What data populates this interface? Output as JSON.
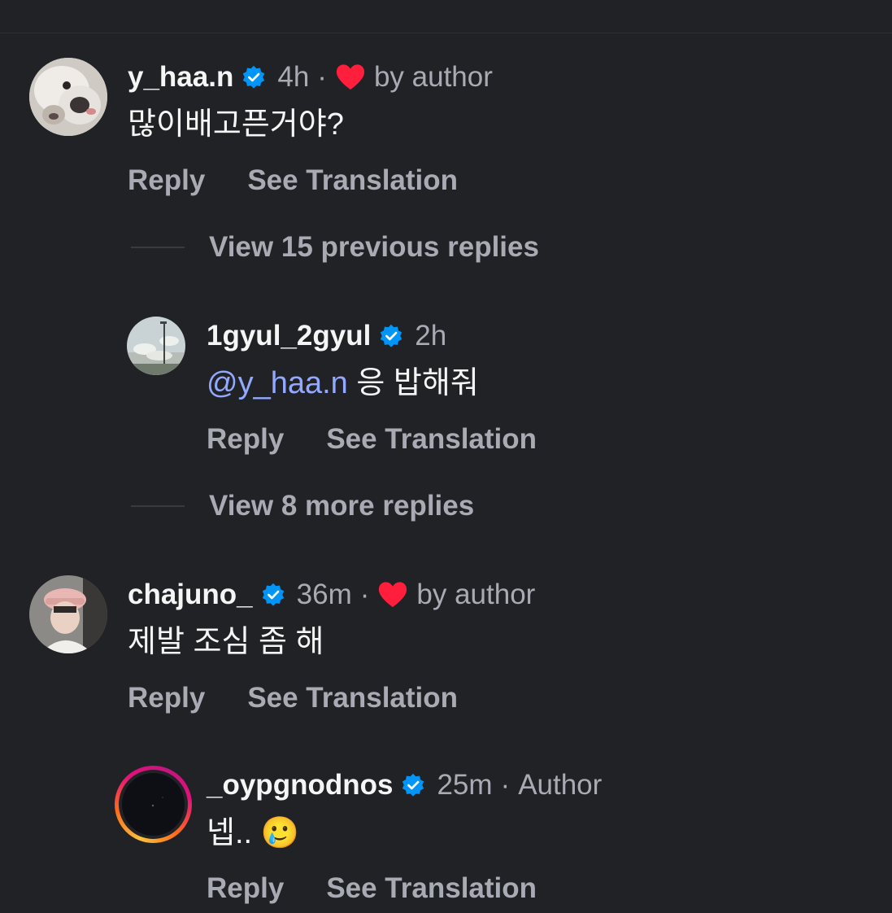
{
  "colors": {
    "background": "#212226",
    "primary_text": "#f5f5f5",
    "secondary_text": "#a8abb3",
    "mention": "#92a9ff",
    "verified_badge": "#0095f6",
    "heart": "#ff1f3d"
  },
  "comments": [
    {
      "username": "y_haa.n",
      "verified": true,
      "time": "4h",
      "liked_by_author": true,
      "liked_label": "by author",
      "text": "많이배고픈거야?",
      "reply_label": "Reply",
      "translate_label": "See Translation",
      "avatar_icon": "avatar-dog-photo",
      "view_previous_label": "View 15 previous replies",
      "replies": [
        {
          "username": "1gyul_2gyul",
          "verified": true,
          "time": "2h",
          "mention": "@y_haa.n",
          "text": "응 밥해줘",
          "reply_label": "Reply",
          "translate_label": "See Translation",
          "avatar_icon": "avatar-sky-photo"
        }
      ],
      "view_more_label": "View 8 more replies"
    },
    {
      "username": "chajuno_",
      "verified": true,
      "time": "36m",
      "liked_by_author": true,
      "liked_label": "by author",
      "text": "제발 조심 좀 해",
      "reply_label": "Reply",
      "translate_label": "See Translation",
      "avatar_icon": "avatar-person-photo",
      "replies": [
        {
          "username": "_oypgnodnos",
          "verified": true,
          "time": "25m",
          "author_label": "Author",
          "text": "넵..",
          "emoji": "🥲",
          "reply_label": "Reply",
          "translate_label": "See Translation",
          "avatar_icon": "avatar-story-ring"
        }
      ]
    }
  ]
}
